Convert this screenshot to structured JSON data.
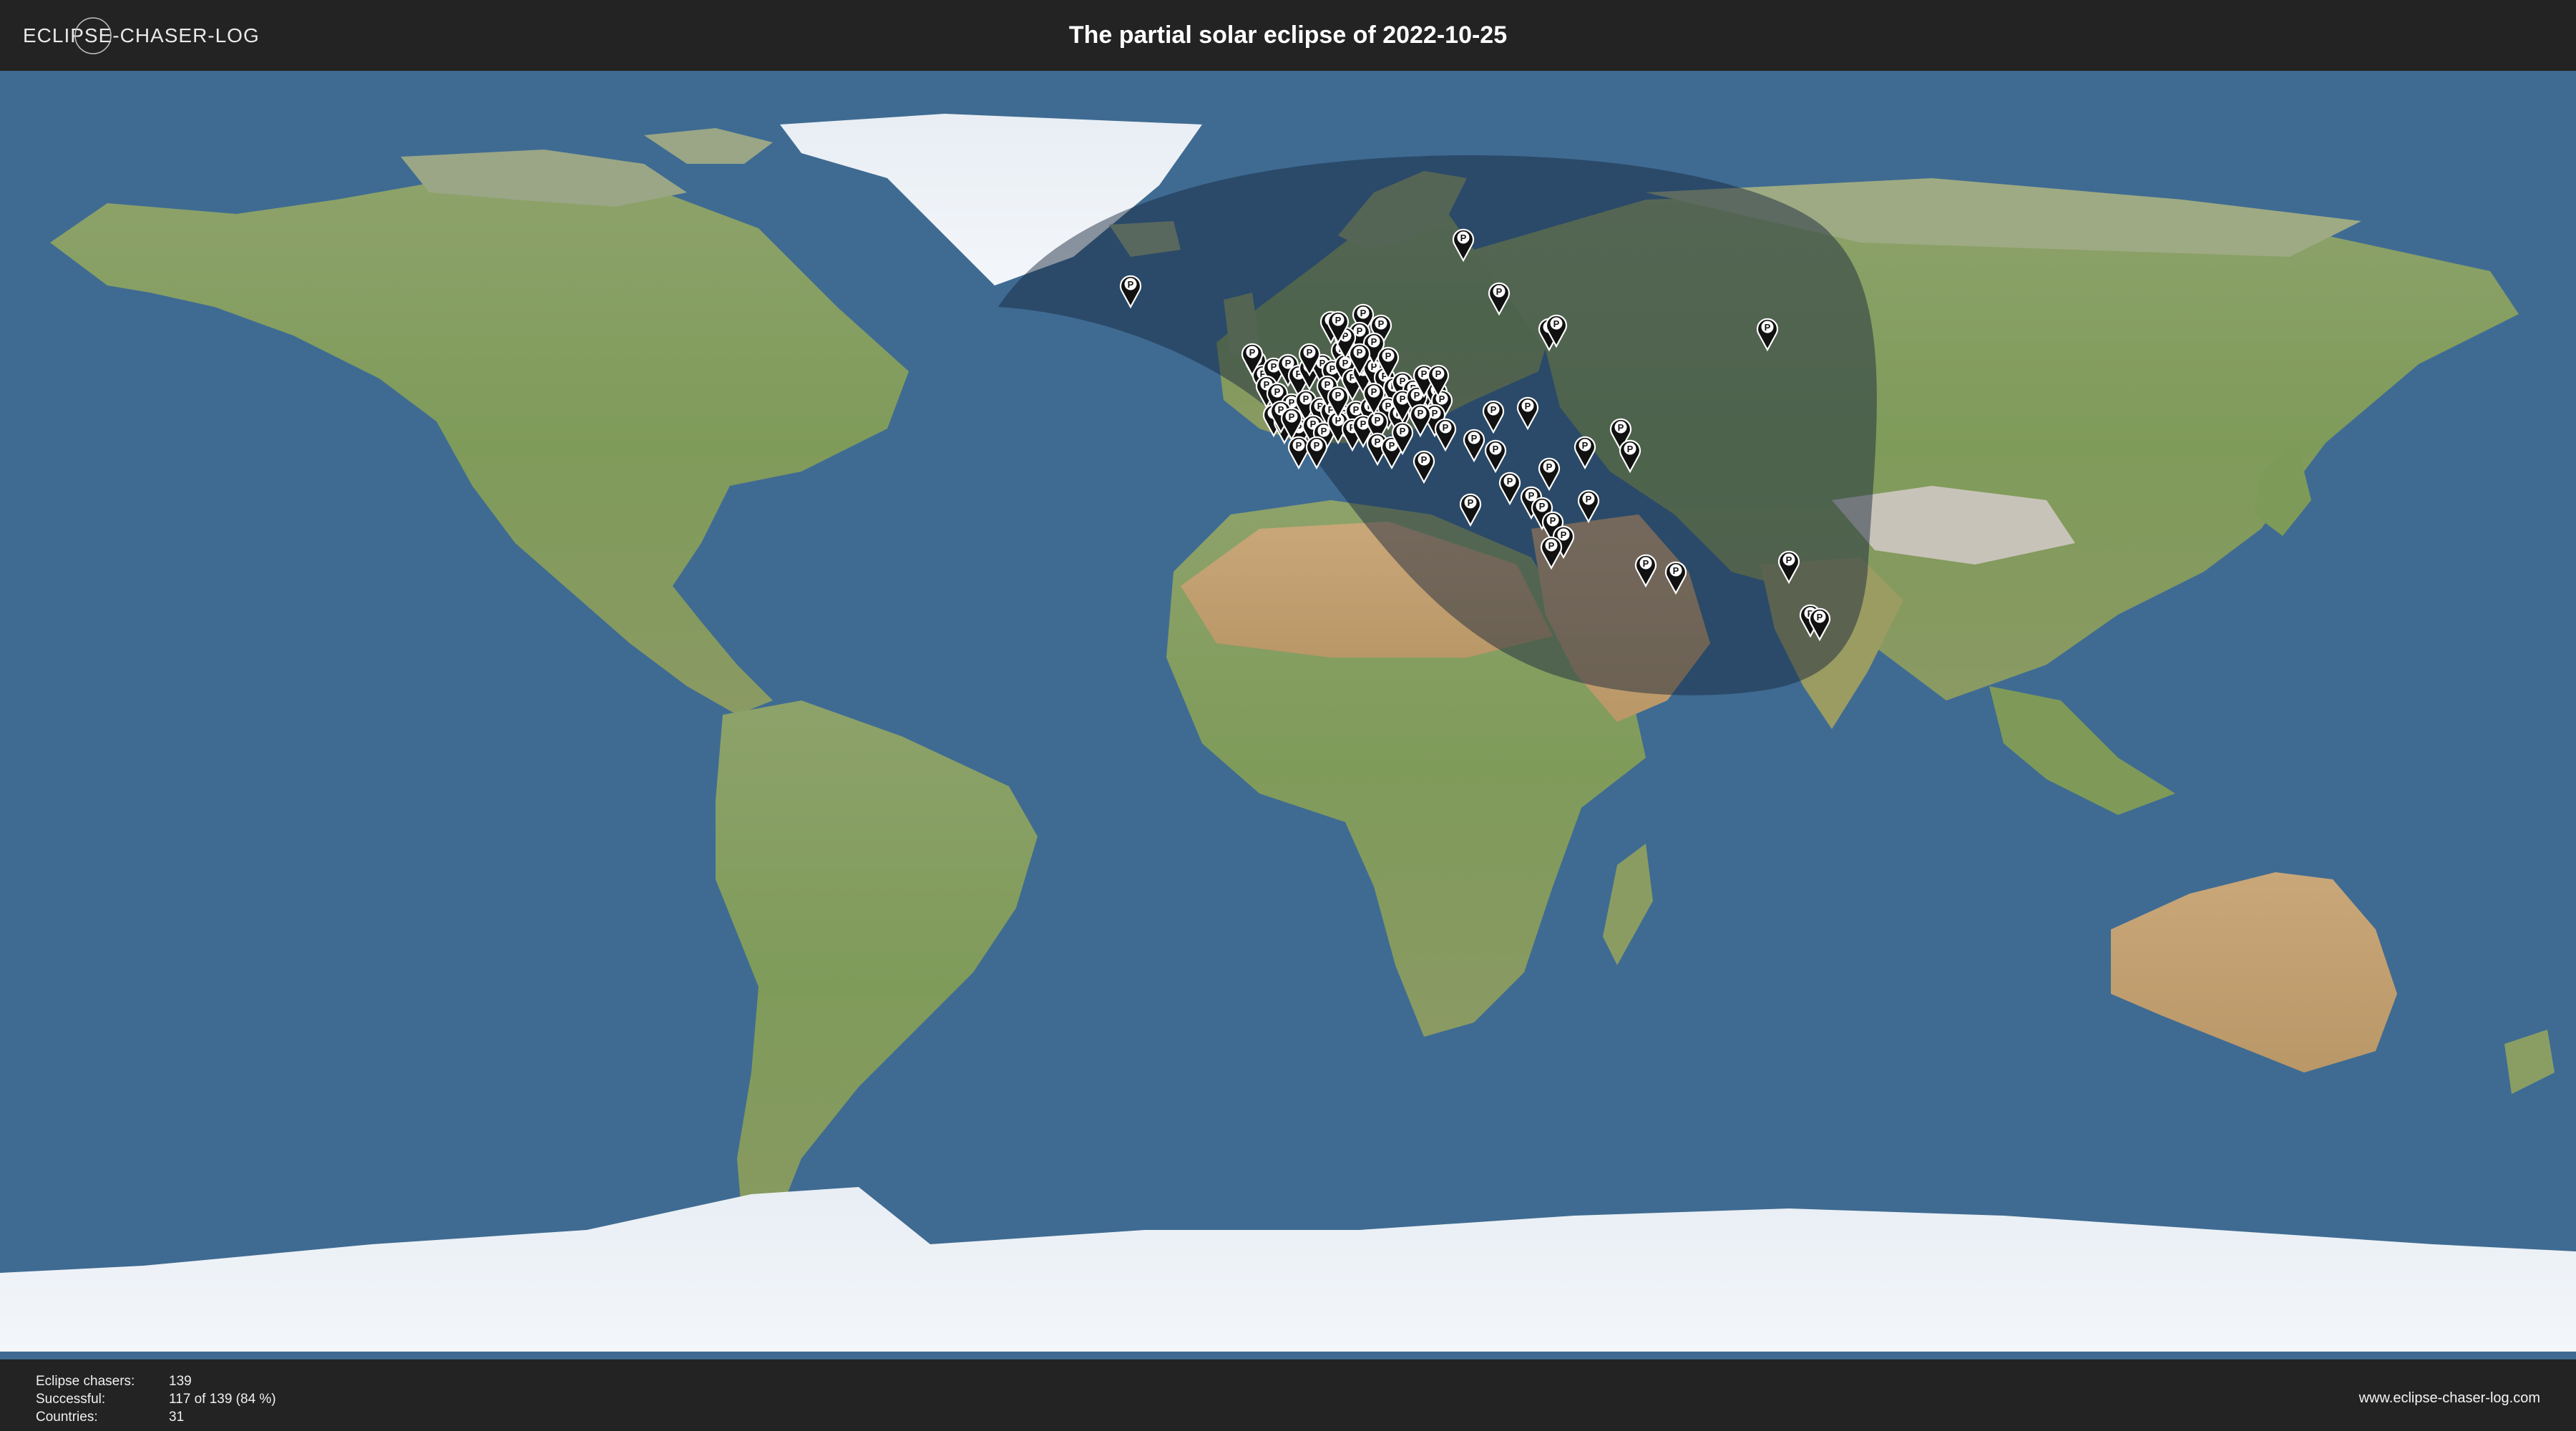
{
  "header": {
    "logo_text": "ECLIPSE-CHASER-LOG",
    "title": "The partial solar eclipse of 2022-10-25"
  },
  "map": {
    "ocean_color": "#3f6b92",
    "shadow_region": "partial eclipse visibility zone",
    "marker_icon": "map-pin-icon",
    "marker_glyph": "P",
    "marker_count_visible": 96
  },
  "stats": [
    {
      "label": "Eclipse chasers:",
      "value": "139"
    },
    {
      "label": "Successful:",
      "value": "117 of 139 (84 %)"
    },
    {
      "label": "Countries:",
      "value": "31"
    }
  ],
  "footer": {
    "website": "www.eclipse-chaser-log.com"
  }
}
